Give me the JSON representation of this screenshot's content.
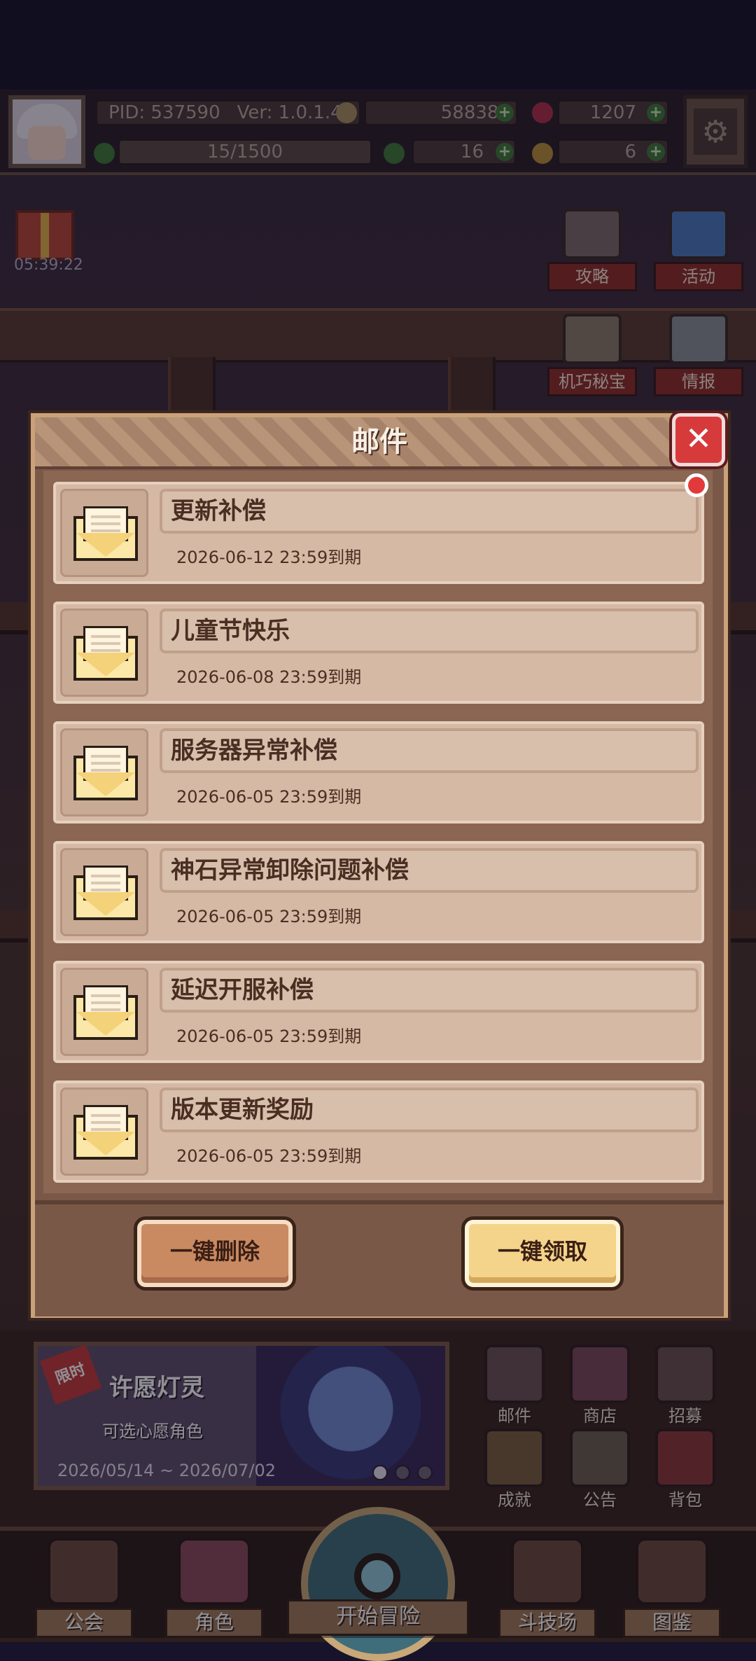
{
  "hud": {
    "pid": "PID: 537590",
    "version": "Ver: 1.0.1.4",
    "gold": "588380",
    "gems": "1207",
    "energy": "15/1500",
    "clover": "16",
    "key": "6",
    "timer": "05:39:22"
  },
  "side_buttons": {
    "guide": "攻略",
    "event": "活动",
    "mechanism": "机巧秘宝",
    "intel": "情报"
  },
  "mail": {
    "title": "邮件",
    "items": [
      {
        "title": "更新补偿",
        "expiry": "2026-06-12 23:59到期"
      },
      {
        "title": "儿童节快乐",
        "expiry": "2026-06-08 23:59到期"
      },
      {
        "title": "服务器异常补偿",
        "expiry": "2026-06-05 23:59到期"
      },
      {
        "title": "神石异常卸除问题补偿",
        "expiry": "2026-06-05 23:59到期"
      },
      {
        "title": "延迟开服补偿",
        "expiry": "2026-06-05 23:59到期"
      },
      {
        "title": "版本更新奖励",
        "expiry": "2026-06-05 23:59到期"
      }
    ],
    "delete_all": "一键删除",
    "claim_all": "一键领取"
  },
  "banner": {
    "tag": "限时",
    "title": "许愿灯灵",
    "subtitle": "可选心愿角色",
    "dates": "2026/05/14 ~ 2026/07/02"
  },
  "grid_buttons": {
    "mail": "邮件",
    "shop": "商店",
    "recruit": "招募",
    "achievement": "成就",
    "notice": "公告",
    "bag": "背包"
  },
  "nav": {
    "guild": "公会",
    "character": "角色",
    "adventure": "开始冒险",
    "arena": "斗技场",
    "codex": "图鉴"
  },
  "colors": {
    "accent_red": "#d63a3a",
    "panel_brown": "#7a5848",
    "item_bg": "#d6b9a4",
    "claim_gold": "#f4d48a"
  }
}
